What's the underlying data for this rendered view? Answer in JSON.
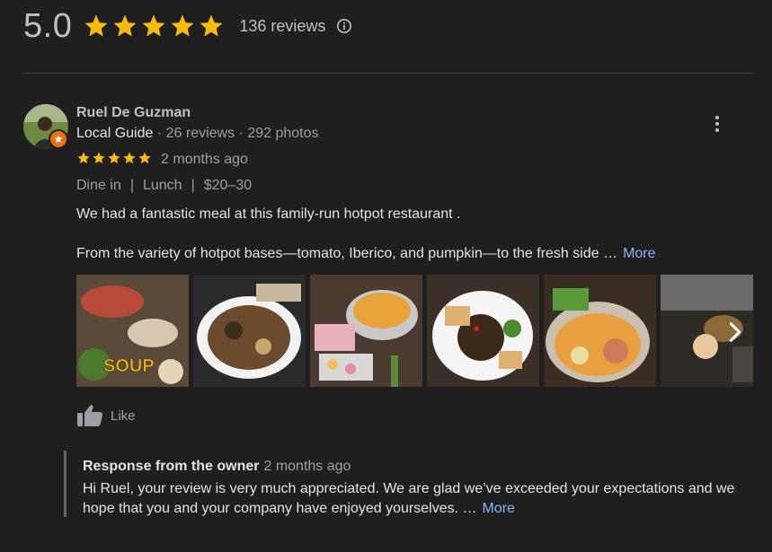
{
  "rating": {
    "value": "5.0",
    "stars": 5,
    "count_label": "136 reviews"
  },
  "review": {
    "author": "Ruel De Guzman",
    "badge": "Local Guide",
    "meta_reviews": "26 reviews",
    "meta_photos": "292 photos",
    "stars": 5,
    "date": "2 months ago",
    "tags": [
      "Dine in",
      "Lunch",
      "$20–30"
    ],
    "text_line1": "We had a fantastic meal at this family-run hotpot restaurant .",
    "text_line2": "From the variety of hotpot bases—tomato, Iberico, and pumpkin—to the fresh side …",
    "more_label": "More",
    "photo_caption": "SOUP",
    "like_label": "Like"
  },
  "owner_response": {
    "title": "Response from the owner",
    "date": "2 months ago",
    "text_line1": "Hi Ruel, your review is very much appreciated. We are glad we’ve exceeded your expectations and we",
    "text_line2": "hope that you and your company have enjoyed yourselves. …",
    "more_label": "More"
  },
  "colors": {
    "star": "#fbbc04",
    "link": "#8ab4f8",
    "background": "#1f1f1f"
  }
}
